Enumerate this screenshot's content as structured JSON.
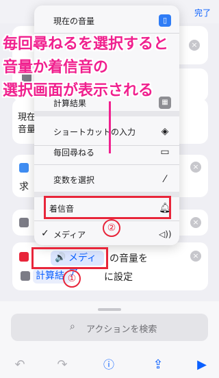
{
  "header": {
    "done_label": "完了"
  },
  "annotation": {
    "lines": [
      "毎回尋ねるを選択すると",
      "音量か着信音の",
      "選択画面が表示される"
    ],
    "step1": "①",
    "step2": "②",
    "color": "#f0208e",
    "box_color": "#e8253a"
  },
  "menu": {
    "items": [
      {
        "label": "現在の音量",
        "icon": "phone-icon"
      },
      {
        "label": "計算結果",
        "icon": "calculator-icon"
      },
      {
        "label": "ショートカットの入力",
        "icon": "layers-icon"
      },
      {
        "label": "毎回尋ねる",
        "icon": "chat-bubble-icon"
      },
      {
        "label": "変数を選択",
        "icon": "magic-wand-icon"
      },
      {
        "label": "着信音",
        "icon": "bell-icon"
      },
      {
        "label": "メディア",
        "icon": "speaker-icon",
        "checked": true
      }
    ],
    "check_mark": "✓"
  },
  "background_cards": {
    "card1_text1": "現在",
    "card1_text2": "音量",
    "card2_text": "求",
    "action_text1": "の音量を",
    "action_text2": "に設定",
    "media_pill": "メディア",
    "calc_pill": "計算結"
  },
  "bottom": {
    "search_placeholder": "アクションを検索"
  },
  "colors": {
    "accent": "#0a60ff",
    "background": "#efeff4"
  }
}
